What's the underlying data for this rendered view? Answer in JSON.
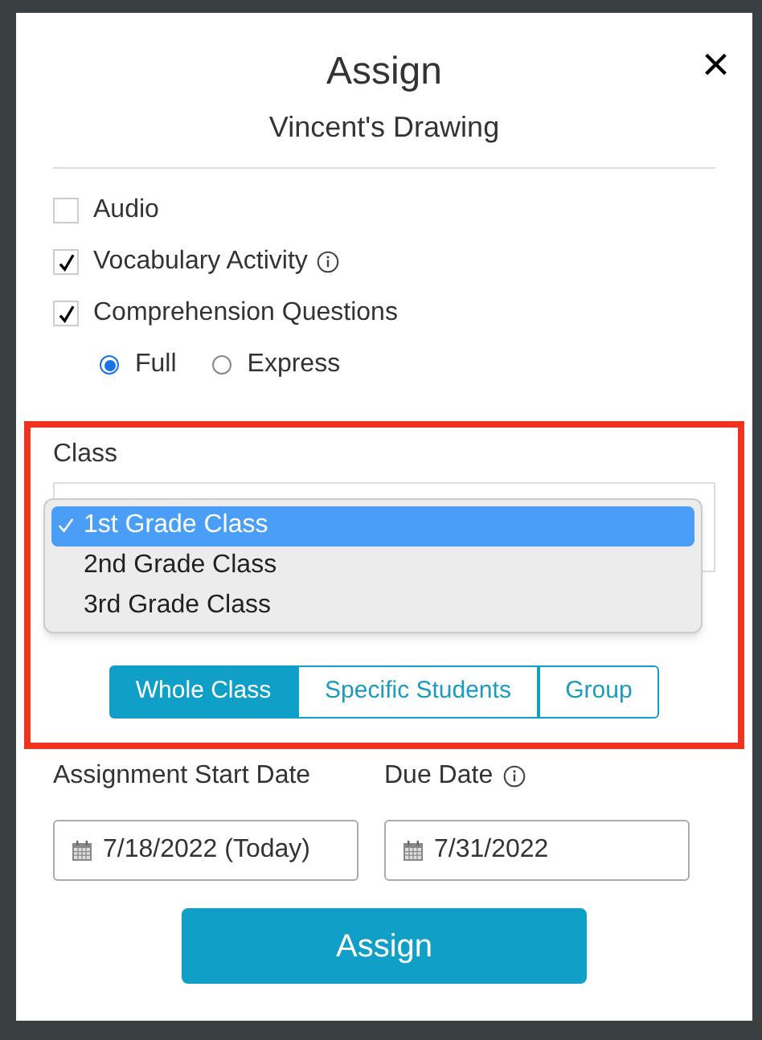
{
  "dialog": {
    "title": "Assign",
    "subtitle": "Vincent's Drawing",
    "close": "×"
  },
  "options": [
    {
      "label": "Audio",
      "checked": false,
      "info": false
    },
    {
      "label": "Vocabulary Activity",
      "checked": true,
      "info": true
    },
    {
      "label": "Comprehension Questions",
      "checked": true,
      "info": false
    }
  ],
  "mode": [
    {
      "label": "Full",
      "selected": true
    },
    {
      "label": "Express",
      "selected": false
    }
  ],
  "class": {
    "label": "Class",
    "options": [
      {
        "label": "1st Grade Class",
        "selected": true
      },
      {
        "label": "2nd Grade Class",
        "selected": false
      },
      {
        "label": "3rd Grade Class",
        "selected": false
      }
    ]
  },
  "assign_to": {
    "segments": [
      {
        "label": "Whole Class",
        "selected": true
      },
      {
        "label": "Specific Students",
        "selected": false
      },
      {
        "label": "Group",
        "selected": false
      }
    ]
  },
  "dates": [
    {
      "label": "Assignment Start Date",
      "value": "7/18/2022 (Today)",
      "info": false
    },
    {
      "label": "Due Date",
      "value": "7/31/2022",
      "info": true
    }
  ],
  "submit": "Assign"
}
